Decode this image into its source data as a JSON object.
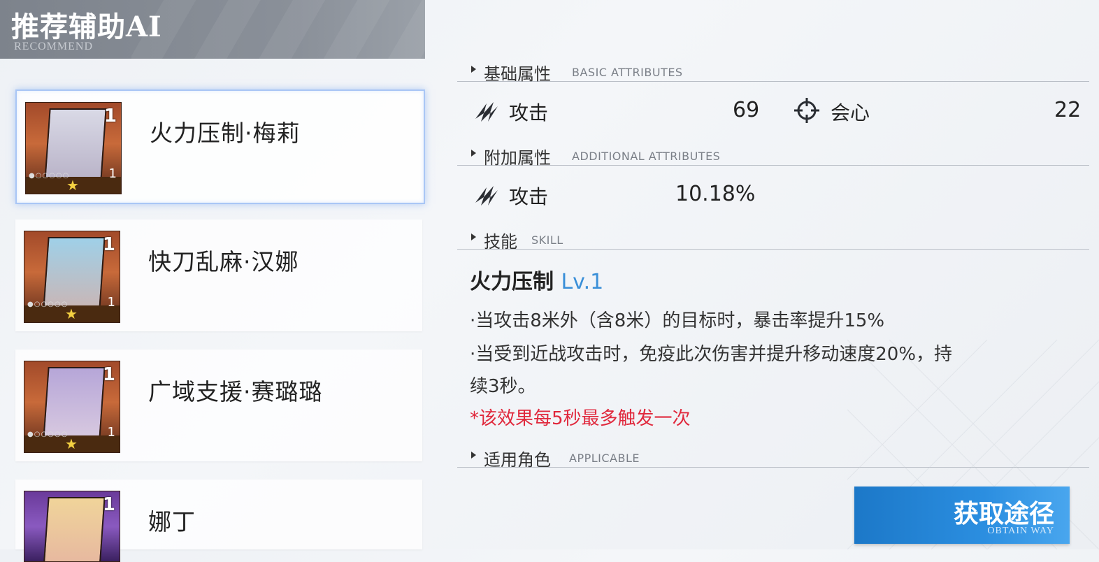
{
  "header": {
    "title": "推荐辅助AI",
    "subtitle": "RECOMMEND"
  },
  "list": [
    {
      "name": "火力压制·梅莉",
      "level": "1",
      "stars": 1,
      "selected": true
    },
    {
      "name": "快刀乱麻·汉娜",
      "level": "1",
      "stars": 1,
      "selected": false
    },
    {
      "name": "广域支援·赛璐璐",
      "level": "1",
      "stars": 1,
      "selected": false
    },
    {
      "name": "娜丁",
      "level": "1",
      "stars": 1,
      "selected": false
    }
  ],
  "sections": {
    "basic": {
      "zh": "基础属性",
      "en": "BASIC ATTRIBUTES"
    },
    "additional": {
      "zh": "附加属性",
      "en": "ADDITIONAL ATTRIBUTES"
    },
    "skill": {
      "zh": "技能",
      "en": "SKILL"
    },
    "applicable": {
      "zh": "适用角色",
      "en": "APPLICABLE"
    }
  },
  "basic_attrs": [
    {
      "label": "攻击",
      "value": "69",
      "icon": "claw-icon"
    },
    {
      "label": "会心",
      "value": "22",
      "icon": "crosshair-icon"
    }
  ],
  "additional_attrs": [
    {
      "label": "攻击",
      "value": "10.18%",
      "icon": "claw-icon"
    }
  ],
  "skill": {
    "name": "火力压制",
    "level": "Lv.1",
    "lines": [
      "·当攻击8米外（含8米）的目标时，暴击率提升15%",
      "·当受到近战攻击时，免疫此次伤害并提升移动速度20%，持",
      "续3秒。"
    ],
    "warning": "*该效果每5秒最多触发一次"
  },
  "obtain_button": {
    "zh": "获取途径",
    "en": "OBTAIN WAY"
  },
  "colors": {
    "accent": "#2b8ee0",
    "warning": "#e0283c",
    "level_blue": "#3a8fd8",
    "selection_glow": "#a9c6f5"
  }
}
